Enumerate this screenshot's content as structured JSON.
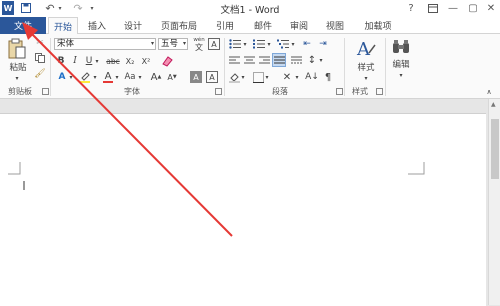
{
  "title_bar": {
    "title": "文档1 - Word",
    "help": "?",
    "quick_access": {
      "save_icon": "save-icon",
      "undo_icon": "undo-icon",
      "redo_icon": "redo-icon"
    }
  },
  "tabs": {
    "file": "文件",
    "items": [
      "开始",
      "插入",
      "设计",
      "页面布局",
      "引用",
      "邮件",
      "审阅",
      "视图",
      "加载项"
    ]
  },
  "ribbon": {
    "clipboard": {
      "paste_label": "粘贴",
      "group_label": "剪贴板"
    },
    "font": {
      "font_name": "宋体",
      "font_size": "五号",
      "wen": "wén",
      "wen_char": "文",
      "strike": "abc",
      "sub": "X₂",
      "sup": "X²",
      "aa_label": "Aa",
      "grow": "A",
      "shrink": "A",
      "a_label": "A",
      "group_label": "字体"
    },
    "paragraph": {
      "group_label": "段落"
    },
    "styles": {
      "label": "样式",
      "group_label": "样式"
    },
    "editing": {
      "label": "编辑"
    }
  },
  "colors": {
    "file_tab": "#2b579a",
    "active_tab_text": "#2b579a",
    "annotation_arrow": "#e53935"
  }
}
